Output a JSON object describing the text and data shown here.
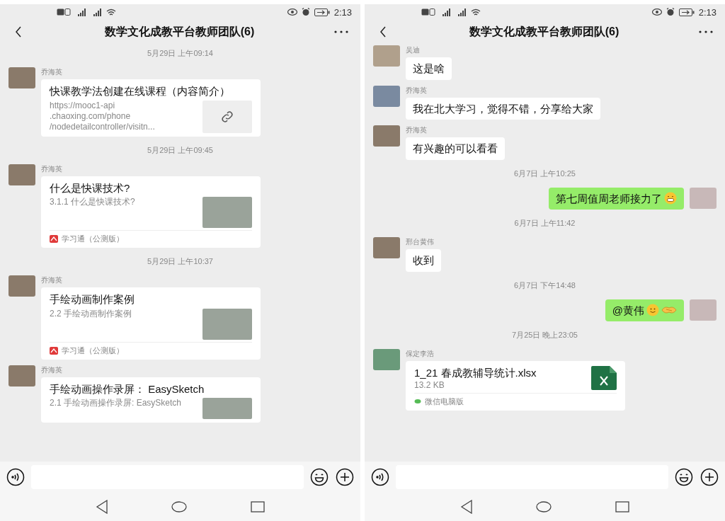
{
  "phones": [
    {
      "status_bar": {
        "time": "2:13"
      },
      "header": {
        "title": "数学文化成教平台教师团队(6)"
      },
      "messages": [
        {
          "kind": "time",
          "text": "5月29日 上午09:14"
        },
        {
          "kind": "link",
          "sender": "乔海英",
          "title": "快课教学法创建在线课程（内容简介）",
          "description_lines": [
            "https://mooc1-api",
            ".chaoxing.com/phone",
            "/nodedetailcontroller/visitn..."
          ]
        },
        {
          "kind": "time",
          "text": "5月29日 上午09:45"
        },
        {
          "kind": "article",
          "sender": "乔海英",
          "title": "什么是快课技术?",
          "description": "3.1.1 什么是快课技术?",
          "source": "学习通（公测版）"
        },
        {
          "kind": "time",
          "text": "5月29日 上午10:37"
        },
        {
          "kind": "article",
          "sender": "乔海英",
          "title": "手绘动画制作案例",
          "description": "2.2 手绘动画制作案例",
          "source": "学习通（公测版）"
        },
        {
          "kind": "article",
          "sender": "乔海英",
          "title": "手绘动画操作录屏： EasySketch",
          "description": "2.1 手绘动画操作录屏: EasySketch"
        }
      ]
    },
    {
      "status_bar": {
        "time": "2:13"
      },
      "header": {
        "title": "数学文化成教平台教师团队(6)"
      },
      "messages": [
        {
          "kind": "text",
          "sender": "吴迪",
          "outgoing": false,
          "text": "这是啥"
        },
        {
          "kind": "text",
          "sender": "乔海英",
          "outgoing": false,
          "text": "我在北大学习，觉得不错，分享给大家"
        },
        {
          "kind": "text",
          "sender": "乔海英",
          "outgoing": false,
          "text": "有兴趣的可以看看"
        },
        {
          "kind": "time",
          "text": "6月7日 上午10:25"
        },
        {
          "kind": "text",
          "outgoing": true,
          "text": "第七周值周老师接力了",
          "stickers": [
            {
              "kind": "grin"
            }
          ]
        },
        {
          "kind": "time",
          "text": "6月7日 上午11:42"
        },
        {
          "kind": "text",
          "sender": "邢台黄伟",
          "outgoing": false,
          "text": "收到"
        },
        {
          "kind": "time",
          "text": "6月7日 下午14:48"
        },
        {
          "kind": "text",
          "outgoing": true,
          "text": "@黄伟",
          "stickers": [
            {
              "kind": "smile"
            },
            {
              "kind": "handshake"
            }
          ]
        },
        {
          "kind": "time",
          "text": "7月25日 晚上23:05"
        },
        {
          "kind": "file",
          "sender": "保定李浩",
          "file_name": "1_21 春成教辅导统计.xlsx",
          "size": "13.2 KB",
          "file_icon": {
            "kind": "spreadsheet"
          },
          "source": "微信电脑版"
        }
      ]
    }
  ]
}
